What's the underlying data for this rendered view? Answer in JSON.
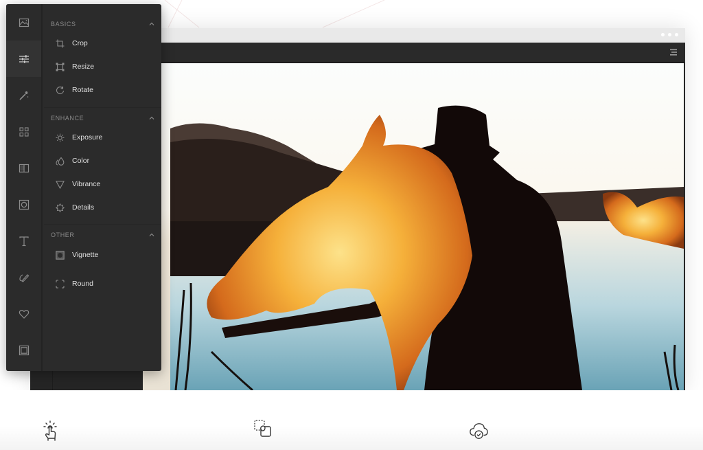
{
  "window": {
    "menu_icon": "hamburger-menu-icon"
  },
  "rail": {
    "items": [
      {
        "name": "image",
        "icon": "image-icon",
        "active": false
      },
      {
        "name": "adjust",
        "icon": "sliders-icon",
        "active": true
      },
      {
        "name": "magic",
        "icon": "magic-wand-icon",
        "active": false
      },
      {
        "name": "grid",
        "icon": "grid-icon",
        "active": false
      },
      {
        "name": "overlay",
        "icon": "overlay-icon",
        "active": false
      },
      {
        "name": "frame",
        "icon": "camera-frame-icon",
        "active": false
      },
      {
        "name": "text",
        "icon": "text-icon",
        "active": false
      },
      {
        "name": "draw",
        "icon": "pencil-icon",
        "active": false
      },
      {
        "name": "stickers",
        "icon": "heart-icon",
        "active": false
      },
      {
        "name": "border",
        "icon": "border-icon",
        "active": false
      }
    ]
  },
  "menu": {
    "sections": [
      {
        "title": "BASICS",
        "items": [
          {
            "label": "Crop",
            "icon": "crop-icon"
          },
          {
            "label": "Resize",
            "icon": "resize-icon"
          },
          {
            "label": "Rotate",
            "icon": "rotate-icon"
          }
        ]
      },
      {
        "title": "ENHANCE",
        "items": [
          {
            "label": "Exposure",
            "icon": "sun-icon"
          },
          {
            "label": "Color",
            "icon": "drops-icon"
          },
          {
            "label": "Vibrance",
            "icon": "triangle-icon"
          },
          {
            "label": "Details",
            "icon": "gear-sun-icon"
          }
        ]
      },
      {
        "title": "OTHER",
        "items": [
          {
            "label": "Vignette",
            "icon": "vignette-icon"
          },
          {
            "label": "Round",
            "icon": "round-corners-icon"
          }
        ]
      }
    ]
  },
  "features": [
    {
      "icon": "tap-hand-icon"
    },
    {
      "icon": "drag-drop-icon"
    },
    {
      "icon": "cloud-check-icon"
    }
  ],
  "colors": {
    "panel": "#2b2b2b",
    "rail_active": "#333333",
    "text": "#e0e0e0",
    "section_label": "#8a8a8a",
    "titlebar": "#e9e9e9"
  }
}
